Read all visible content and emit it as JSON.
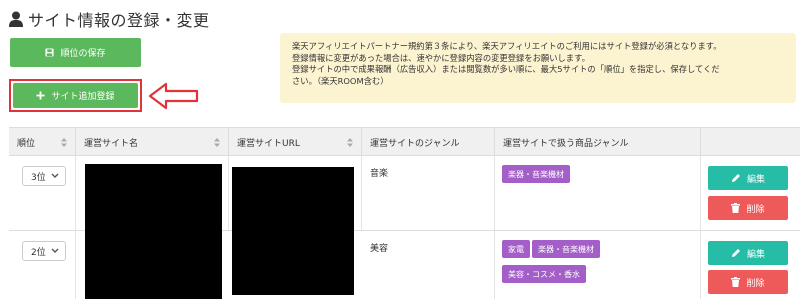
{
  "page": {
    "title": "サイト情報の登録・変更"
  },
  "buttons": {
    "save_order": "順位の保存",
    "add_site": "サイト追加登録"
  },
  "notice": {
    "lines": [
      "楽天アフィリエイトパートナー規約第３条により、楽天アフィリエイトのご利用にはサイト登録が必須となります。",
      "登録情報に変更があった場合は、速やかに登録内容の変更登録をお願いします。",
      "登録サイトの中で成果報酬（広告収入）または閲覧数が多い順に、最大5サイトの「順位」を指定し、保存してくだ",
      "さい。（楽天ROOM含む）"
    ]
  },
  "table": {
    "headers": [
      "順位",
      "運営サイト名",
      "運営サイトURL",
      "運営サイトのジャンル",
      "運営サイトで扱う商品ジャンル"
    ],
    "rows": [
      {
        "rank": "3位",
        "genre": "音楽",
        "tags": [
          "楽器・音楽機材"
        ],
        "edit": "編集",
        "delete": "削除"
      },
      {
        "rank": "2位",
        "genre": "美容",
        "tags": [
          "家電",
          "楽器・音楽機材",
          "美容・コスメ・香水"
        ],
        "edit": "編集",
        "delete": "削除"
      }
    ]
  },
  "colors": {
    "green": "#5cb85c",
    "teal": "#27bca6",
    "red": "#ee5a5a",
    "purple": "#a35fc7",
    "notice_bg": "#fcf3d1",
    "highlight": "#e0333a"
  },
  "icons": [
    "user-icon",
    "save-icon",
    "plus-icon",
    "left-arrow-icon",
    "sort-icon",
    "chevron-down-icon",
    "pencil-icon",
    "trash-icon"
  ]
}
